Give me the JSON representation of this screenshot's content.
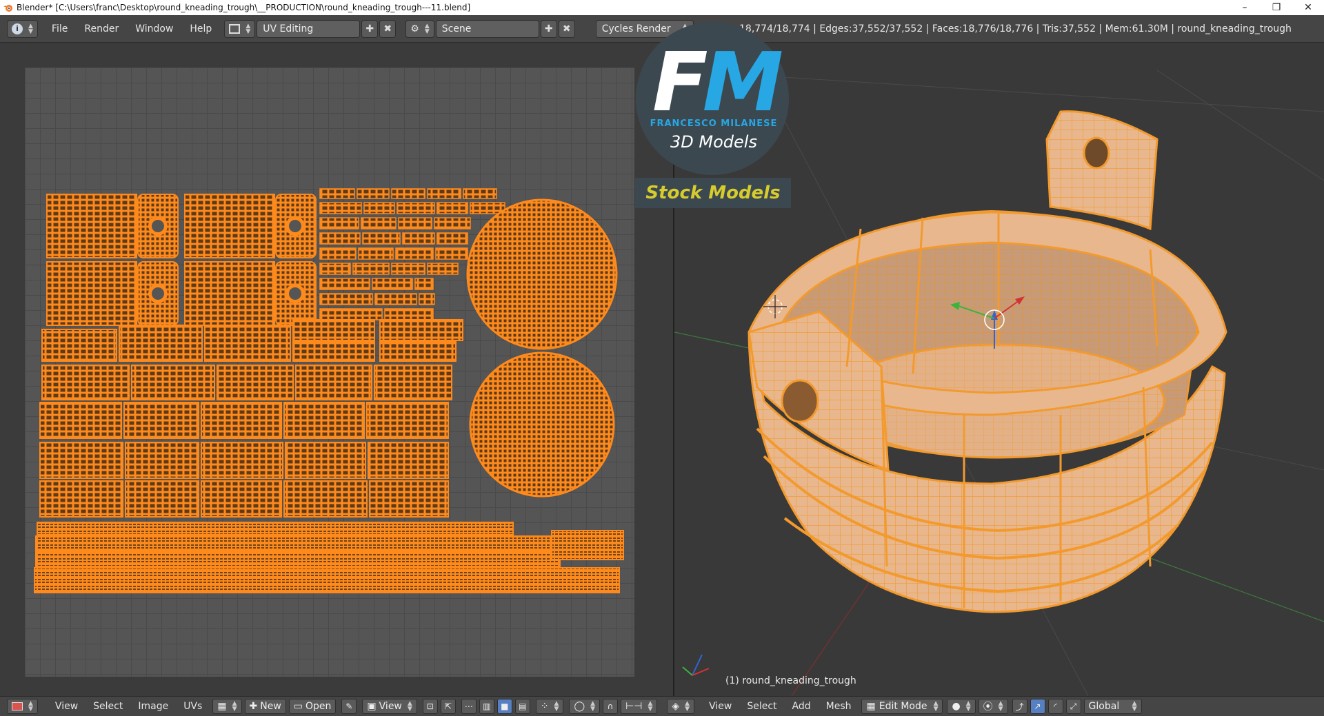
{
  "window": {
    "title": "Blender* [C:\\Users\\franc\\Desktop\\round_kneading_trough\\__PRODUCTION\\round_kneading_trough---11.blend]",
    "controls": [
      "minimize",
      "restore",
      "close"
    ]
  },
  "info_header": {
    "menu": [
      "File",
      "Render",
      "Window",
      "Help"
    ],
    "screen_layout": "UV Editing",
    "scene": "Scene",
    "render_engine": "Cycles Render",
    "stats": "s:18,774/18,774 | Edges:37,552/37,552 | Faces:18,776/18,776 | Tris:37,552 | Mem:61.30M | round_kneading_trough"
  },
  "uv_editor_header": {
    "menu": [
      "View",
      "Select",
      "Image",
      "UVs"
    ],
    "new_label": "New",
    "open_label": "Open",
    "view_label": "View"
  },
  "viewport": {
    "object_label": "(1) round_kneading_trough"
  },
  "viewport_header": {
    "menu": [
      "View",
      "Select",
      "Add",
      "Mesh"
    ],
    "mode": "Edit Mode",
    "orientation": "Global"
  },
  "watermark": {
    "letter_f": "F",
    "letter_m": "M",
    "author": "FRANCESCO MILANESE",
    "subtitle": "3D Models",
    "badge": "Stock Models"
  },
  "colors": {
    "uv_orange": "#ff8a1c",
    "mesh_wire": "#f39a2e",
    "background": "#393939",
    "header": "#454545",
    "logo_blue": "#27a7e3",
    "logo_yellow": "#d6cc2d"
  },
  "icons": [
    "blender-logo-icon",
    "info-editor-icon",
    "screen-layout-icon",
    "scene-icon",
    "image-editor-icon",
    "3d-view-icon",
    "pin-icon",
    "sphere-shading-icon",
    "manipulator-icon"
  ]
}
